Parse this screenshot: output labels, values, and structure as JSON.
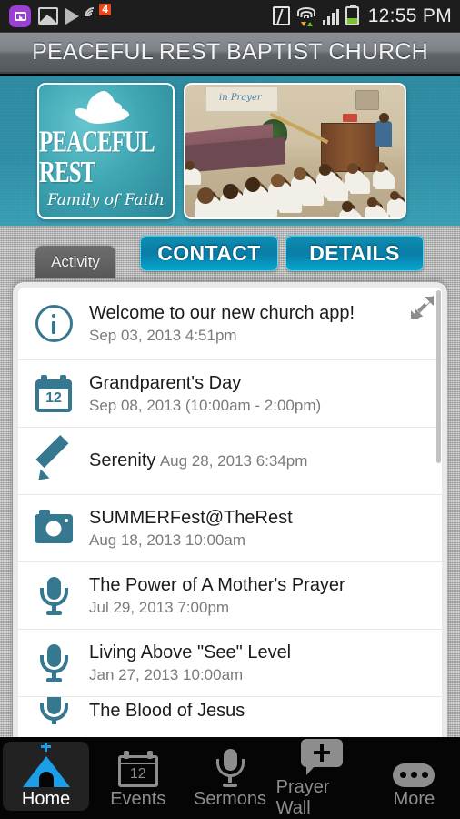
{
  "statusbar": {
    "time": "12:55 PM",
    "notification_badge": "4",
    "icons": [
      "cast-icon",
      "gallery-icon",
      "play-icon",
      "sound-icon",
      "nfc-icon",
      "wifi-icon",
      "signal-icon",
      "battery-icon"
    ]
  },
  "header": {
    "title": "PEACEFUL REST BAPTIST CHURCH"
  },
  "banner": {
    "logo": {
      "name": "PEACEFUL REST",
      "tagline": "Family of Faith",
      "alt": "peaceful-rest-dove-logo"
    },
    "photo": {
      "alt": "congregation-in-prayer-photo",
      "overlay_text": "in Prayer"
    }
  },
  "tabs": {
    "activity_label": "Activity",
    "contact_label": "CONTACT",
    "details_label": "DETAILS"
  },
  "activity_list": {
    "expand_icon": "expand-icon",
    "items": [
      {
        "icon": "info-icon",
        "title": "Welcome to our new church app!",
        "meta": "Sep 03, 2013 4:51pm"
      },
      {
        "icon": "calendar-icon",
        "title": "Grandparent's Day",
        "meta": "Sep 08, 2013 (10:00am - 2:00pm)",
        "day": "12"
      },
      {
        "icon": "pencil-icon",
        "title": "Serenity",
        "meta": "Aug 28, 2013 6:34pm"
      },
      {
        "icon": "camera-icon",
        "title": "SUMMERFest@TheRest",
        "meta": "Aug 18, 2013 10:00am"
      },
      {
        "icon": "microphone-icon",
        "title": "The Power of A Mother's Prayer",
        "meta": "Jul 29, 2013 7:00pm"
      },
      {
        "icon": "microphone-icon",
        "title": "Living Above \"See\" Level",
        "meta": "Jan 27, 2013 10:00am"
      },
      {
        "icon": "microphone-icon",
        "title": "The Blood of Jesus",
        "meta": ""
      }
    ]
  },
  "bottom_nav": {
    "items": [
      {
        "label": "Home",
        "icon": "church-icon",
        "active": true
      },
      {
        "label": "Events",
        "icon": "calendar-icon",
        "active": false,
        "day": "12"
      },
      {
        "label": "Sermons",
        "icon": "microphone-icon",
        "active": false
      },
      {
        "label": "Prayer Wall",
        "icon": "prayer-bubble-icon",
        "active": false
      },
      {
        "label": "More",
        "icon": "ellipsis-icon",
        "active": false
      }
    ]
  },
  "colors": {
    "accent_teal": "#35788f",
    "banner_teal": "#2f8fa6",
    "button_blue": "#0a7fa6",
    "active_nav_blue": "#1a9fe8",
    "badge_red": "#e8491b",
    "battery_green": "#7dc030"
  }
}
